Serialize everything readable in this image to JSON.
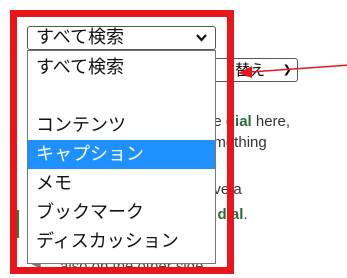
{
  "search_select": {
    "value": "すべて検索",
    "options": [
      "すべて検索",
      "",
      "コンテンツ",
      "キャプション",
      "メモ",
      "ブックマーク",
      "ディスカッション"
    ],
    "selected_option": "キャプション"
  },
  "sort_select": {
    "value": "替え"
  },
  "background_text": {
    "line1_prefix": "de ",
    "line1_bold": "dial",
    "line1_suffix": " here,",
    "line2": "omething",
    "line3": "ave a",
    "line4_prefix": "e ",
    "line4_bold": "dial",
    "line4_suffix": ".",
    "line5": "also on the other side"
  },
  "colors": {
    "highlight": "#1e90ff",
    "annotation": "#e8161b",
    "accent_green": "#2e7d3a"
  },
  "icons": {
    "select_arrow": "chevron-down-icon",
    "annotation_arrow": "arrow-left-icon"
  }
}
